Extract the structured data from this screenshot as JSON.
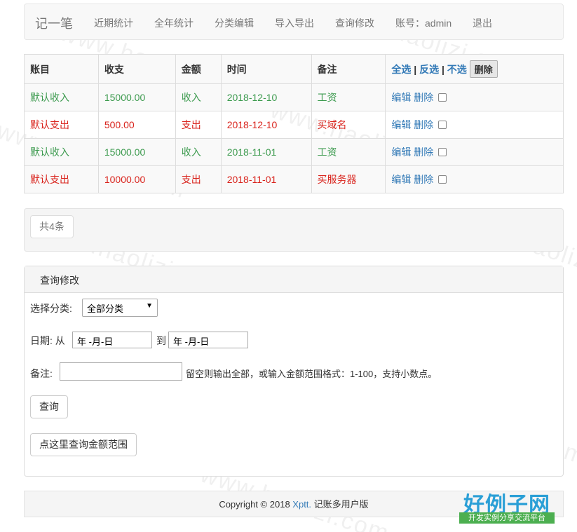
{
  "navbar": {
    "brand": "记一笔",
    "items": [
      "近期统计",
      "全年统计",
      "分类编辑",
      "导入导出",
      "查询修改"
    ],
    "account_label": "账号：admin",
    "logout": "退出"
  },
  "table": {
    "headers": [
      "账目",
      "收支",
      "金额",
      "时间",
      "备注"
    ],
    "actions": {
      "select_all": "全选",
      "invert": "反选",
      "none": "不选",
      "sep": "|",
      "delete": "删除"
    },
    "rows": [
      {
        "category": "默认收入",
        "amount": "15000.00",
        "type": "收入",
        "date": "2018-12-10",
        "note": "工资",
        "edit": "编辑",
        "delete": "删除"
      },
      {
        "category": "默认支出",
        "amount": "500.00",
        "type": "支出",
        "date": "2018-12-10",
        "note": "买域名",
        "edit": "编辑",
        "delete": "删除"
      },
      {
        "category": "默认收入",
        "amount": "15000.00",
        "type": "收入",
        "date": "2018-11-01",
        "note": "工资",
        "edit": "编辑",
        "delete": "删除"
      },
      {
        "category": "默认支出",
        "amount": "10000.00",
        "type": "支出",
        "date": "2018-11-01",
        "note": "买服务器",
        "edit": "编辑",
        "delete": "删除"
      }
    ]
  },
  "pager": {
    "total": "共4条"
  },
  "query": {
    "title": "查询修改",
    "category_label": "选择分类:",
    "category_value": "全部分类",
    "date_label": "日期: 从",
    "date_to": "到",
    "date_placeholder": "年 -月-日",
    "remark_label": "备注:",
    "remark_hint": "留空则输出全部，或输入金额范围格式：1-100，支持小数点。",
    "submit": "查询",
    "range_button": "点这里查询金额范围"
  },
  "footer": {
    "copyright": "Copyright © 2018",
    "link": "Xptt.",
    "suffix": "记账多用户版"
  },
  "watermark": "www.haolizi.com",
  "logo": {
    "main": "好例子网",
    "sub": "开发实例分享交流平台"
  },
  "colors": {
    "income": "#3c9a4e",
    "expense": "#d9231c",
    "link": "#337ab7"
  }
}
